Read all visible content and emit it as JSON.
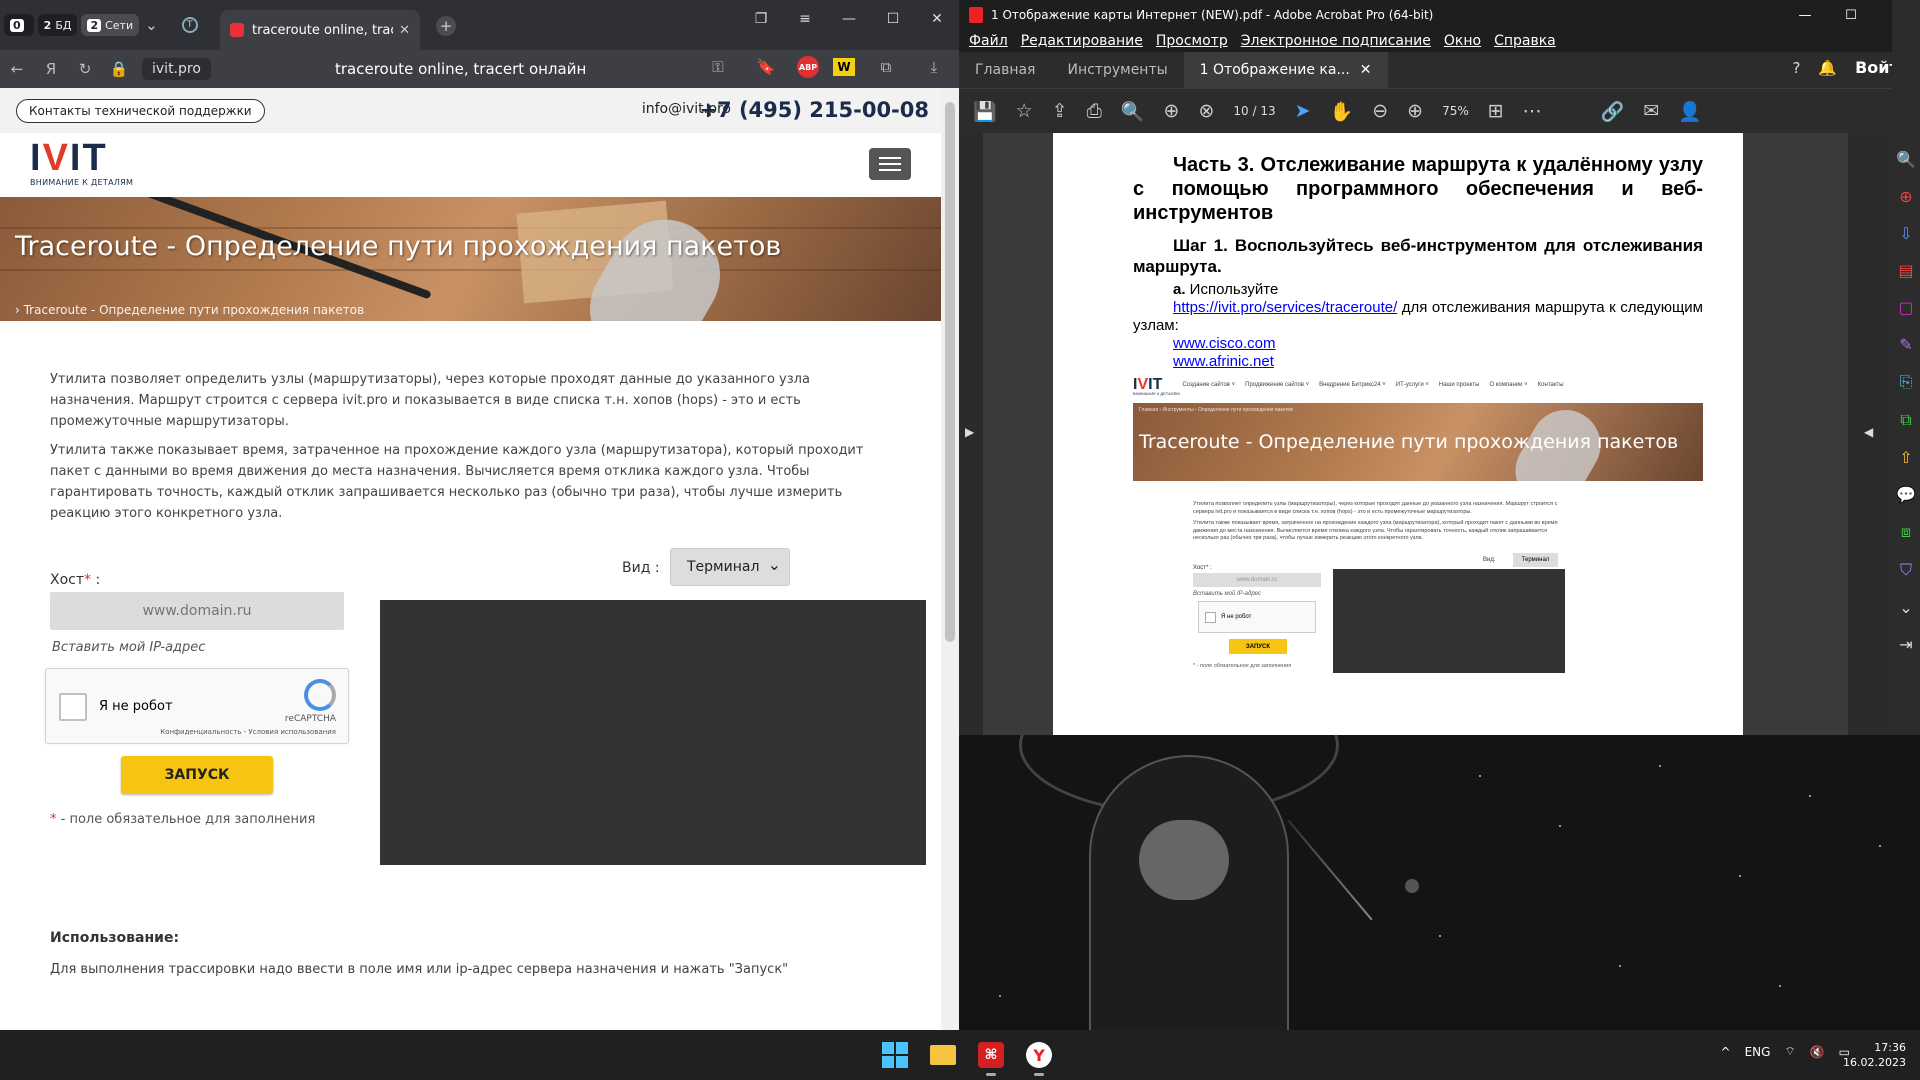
{
  "browser": {
    "tab_pills": [
      {
        "num": "0",
        "label": ""
      },
      {
        "num": "2",
        "label": "БД"
      },
      {
        "num": "2",
        "label": "Сети"
      }
    ],
    "active_tab_title": "traceroute online, tracer",
    "url": "ivit.pro",
    "address_title": "traceroute online, tracert онлайн",
    "abp_badge": "ABP"
  },
  "site": {
    "support_button": "Контакты технической поддержки",
    "email": "info@ivit.pro",
    "phone": "+7 (495) 215-00-08",
    "logo_text": "IVIT",
    "logo_tagline": "ВНИМАНИЕ К ДЕТАЛЯМ",
    "hero_title": "Traceroute - Определение пути прохождения пакетов",
    "breadcrumb": "› Traceroute - Определение пути прохождения пакетов",
    "para1": "Утилита позволяет определить узлы (маршрутизаторы), через которые проходят данные до указанного узла назначения. Маршрут строится с сервера ivit.pro и показывается в виде списка т.н. хопов (hops) - это и есть промежуточные маршрутизаторы.",
    "para2": "Утилита также показывает время, затраченное на прохождение каждого узла (маршрутизатора), который проходит пакет с данными во время движения до места назначения. Вычисляется время отклика каждого узла. Чтобы гарантировать точность, каждый отклик запрашивается несколько раз (обычно три раза), чтобы лучше измерить реакцию этого конкретного узла.",
    "host_label": "Хост",
    "host_required": "*",
    "host_colon": " :",
    "host_placeholder": "www.domain.ru",
    "insert_ip": "Вставить мой IP-адрес",
    "captcha_label": "Я не робот",
    "captcha_brand": "reCAPTCHA",
    "captcha_privacy": "Конфиденциальность - Условия использования",
    "start_button": "ЗАПУСК",
    "required_star": "*",
    "required_note": " - поле обязательное для заполнения",
    "view_label": "Вид :",
    "view_value": "Терминал",
    "usage_heading": "Использование:",
    "usage_text": "Для выполнения трассировки надо ввести в поле имя или ip-адрес сервера назначения и нажать \"Запуск\""
  },
  "acrobat": {
    "window_title": "1 Отображение карты Интернет (NEW).pdf - Adobe Acrobat Pro (64-bit)",
    "menu": [
      "Файл",
      "Редактирование",
      "Просмотр",
      "Электронное подписание",
      "Окно",
      "Справка"
    ],
    "tabs": [
      "Главная",
      "Инструменты"
    ],
    "doc_tab": "1 Отображение ка...",
    "login": "Войти",
    "page_current": "10",
    "page_sep": "/",
    "page_total": "13",
    "zoom": "75%",
    "pdf": {
      "heading": "Часть 3. Отслеживание маршрута к удалённому узлу с помощью программного обеспечения и веб-инструментов",
      "step": "Шаг 1. Воспользуйтесь веб-инструментом для отслеживания маршрута.",
      "a_prefix": "а.",
      "a_use": " Используйте",
      "a_link": "https://ivit.pro/services/traceroute/",
      "a_rest": " для отслеживания маршрута к следующим узлам:",
      "link_cisco": "www.cisco.com",
      "link_afrinic": "www.afrinic.net",
      "shot": {
        "nav": [
          "Создание сайтов ˅",
          "Продвижение сайтов ˅",
          "Внедрение Битрикс24 ˅",
          "ИТ-услуги ˅",
          "Наши проекты",
          "О компании ˅",
          "Контакты"
        ],
        "logo": "IVIT",
        "logo_tag": "ВНИМАНИЕ К ДЕТАЛЯМ",
        "crumb": "Главная › Инструменты › Определение пути прохождения пакетов",
        "hero_title": "Traceroute - Определение пути прохождения пакетов",
        "text1": "Утилита позволяет определить узлы (маршрутизаторы), через которые проходят данные до указанного узла назначения. Маршрут строится с сервера ivit.pro и показывается в виде списка т.н. хопов (hops) - это и есть промежуточные маршрутизаторы.",
        "text2": "Утилита также показывает время, затраченное на прохождение каждого узла (маршрутизатора), который проходит пакет с данными во время движения до места назначения. Вычисляется время отклика каждого узла. Чтобы гарантировать точность, каждый отклик запрашивается несколько раз (обычно три раза), чтобы лучше измерить реакцию этого конкретного узла.",
        "view": "Вид:",
        "select": "Терминал",
        "host": "Хост* :",
        "placeholder": "www.domain.ru",
        "insert_ip": "Вставить мой IP-адрес",
        "captcha": "Я не робот",
        "button": "ЗАПУСК",
        "note_star": "*",
        "note": " - поле обязательное для заполнения"
      }
    }
  },
  "taskbar": {
    "lang": "ENG",
    "time": "17:36",
    "date": "16.02.2023"
  }
}
